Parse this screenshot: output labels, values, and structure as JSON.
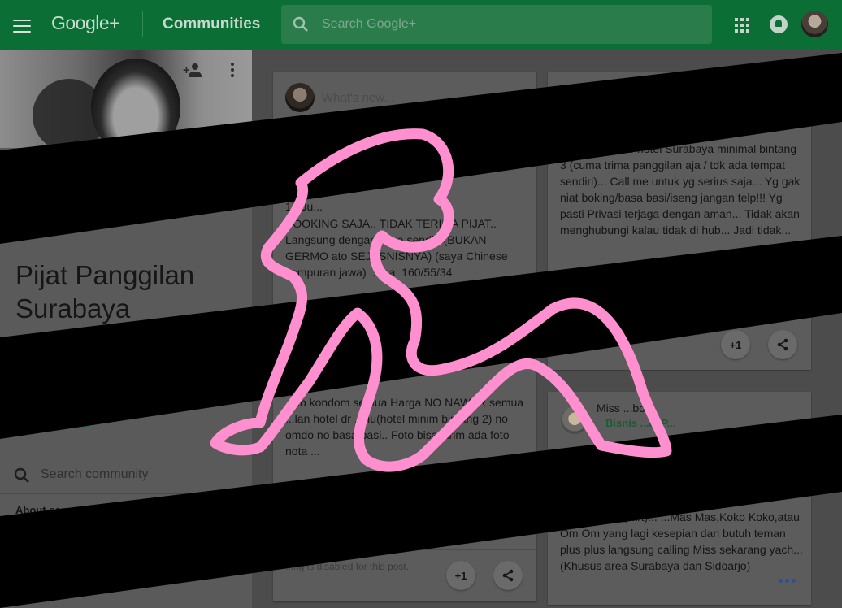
{
  "header": {
    "logo": "Google+",
    "section_title": "Communities",
    "search_placeholder": "Search Google+"
  },
  "community": {
    "title": "Pijat Panggilan Surabaya",
    "search_placeholder": "Search community",
    "about_heading": "About commu..."
  },
  "share_box": {
    "prompt": "What's new..."
  },
  "posts": [
    {
      "date": "17 Ju...",
      "text_top": "BOOKING SAJA.. TIDAK TERIMA PIJAT.. Langsung dengan saya sendiri (BUKAN GERMO ato SEJESNISNYA) (saya Chinese campuran jawa) ...bra: 160/55/34",
      "text_bottom": "...jib kondom semua Harga NO NAWAR semua ...lan hotel dr ...nu(hotel minim bintang 2) no omdo no basa basi.. Foto bisa kirim ada foto nota ...",
      "footer": "...ng is disabled for this post.",
      "plus_one": "+1"
    },
    {
      "text": "...panggilan ke hotel Surabaya minimal bintang 3 (cuma trima panggilan aja / tdk ada tempat sendiri)... Call me untuk yg serius saja... Yg gak niat boking/basa basi/iseng jangan telp!!! Yg pasti Privasi terjaga dengan aman... Tidak akan menghubungi kalau tidak di hub... Jadi tidak...",
      "plus_one": "+1"
    },
    {
      "author": "Miss ...bora",
      "community_link": "Bisnis ...at P...",
      "text": "...ar rumah/apart)... ...Mas Mas,Koko Koko,atau Om Om yang lagi kesepian dan butuh teman plus plus langsung calling Miss sekarang yach... (Khusus area Surabaya dan Sidoarjo)"
    }
  ],
  "colors": {
    "topbar": "#0b6e35",
    "censor_bars": "#000000",
    "censor_silhouette": "#ff8fcf"
  }
}
